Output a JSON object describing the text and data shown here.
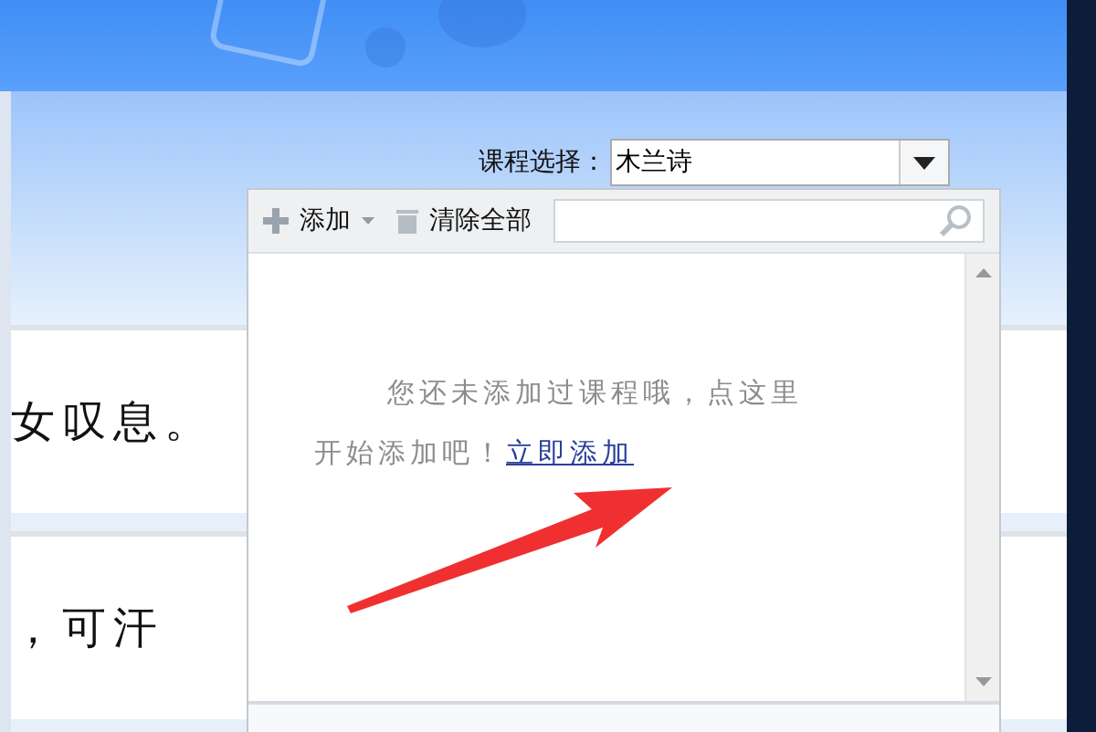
{
  "course_select": {
    "label": "课程选择：",
    "value": "木兰诗"
  },
  "lines": [
    "女叹息。",
    "，可汗"
  ],
  "popup": {
    "add": "添加",
    "clear": "清除全部",
    "message": "您还未添加过课程哦，点这里",
    "message_2": "开始添加吧！",
    "link": "立即添加"
  }
}
